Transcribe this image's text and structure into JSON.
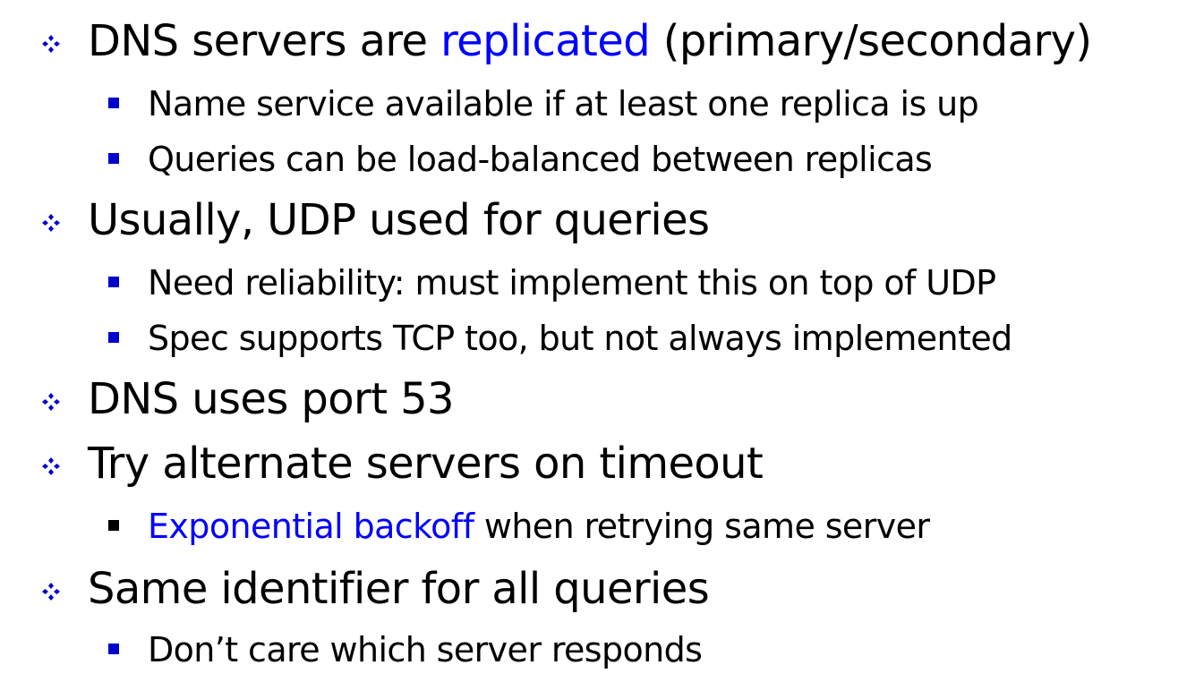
{
  "colors": {
    "text": "#000000",
    "highlight": "#0000ff",
    "bullet_blue": "#0000cc",
    "bullet_black": "#000000"
  },
  "icons": {
    "level1": "four-diamond-bullet-icon",
    "level2": "square-bullet-icon"
  },
  "bullets": [
    {
      "parts": [
        {
          "text": "DNS servers are ",
          "highlight": false
        },
        {
          "text": "replicated",
          "highlight": true
        },
        {
          "text": " (primary/secondary)",
          "highlight": false
        }
      ],
      "children": [
        {
          "parts": [
            {
              "text": "Name service available if at least one replica is up",
              "highlight": false
            }
          ],
          "bullet_color": "blue"
        },
        {
          "parts": [
            {
              "text": "Queries can be load-balanced between replicas",
              "highlight": false
            }
          ],
          "bullet_color": "blue"
        }
      ]
    },
    {
      "parts": [
        {
          "text": "Usually, UDP used for queries",
          "highlight": false
        }
      ],
      "children": [
        {
          "parts": [
            {
              "text": "Need reliability: must implement this on top of UDP",
              "highlight": false
            }
          ],
          "bullet_color": "blue"
        },
        {
          "parts": [
            {
              "text": "Spec supports TCP too, but not always implemented",
              "highlight": false
            }
          ],
          "bullet_color": "blue"
        }
      ]
    },
    {
      "parts": [
        {
          "text": "DNS uses port 53",
          "highlight": false
        }
      ],
      "children": []
    },
    {
      "parts": [
        {
          "text": "Try alternate servers on timeout",
          "highlight": false
        }
      ],
      "children": [
        {
          "parts": [
            {
              "text": "Exponential backoff",
              "highlight": true
            },
            {
              "text": " when retrying same server",
              "highlight": false
            }
          ],
          "bullet_color": "black"
        }
      ]
    },
    {
      "parts": [
        {
          "text": "Same identifier for all queries",
          "highlight": false
        }
      ],
      "children": [
        {
          "parts": [
            {
              "text": "Don’t care which server responds",
              "highlight": false
            }
          ],
          "bullet_color": "blue"
        }
      ]
    }
  ]
}
